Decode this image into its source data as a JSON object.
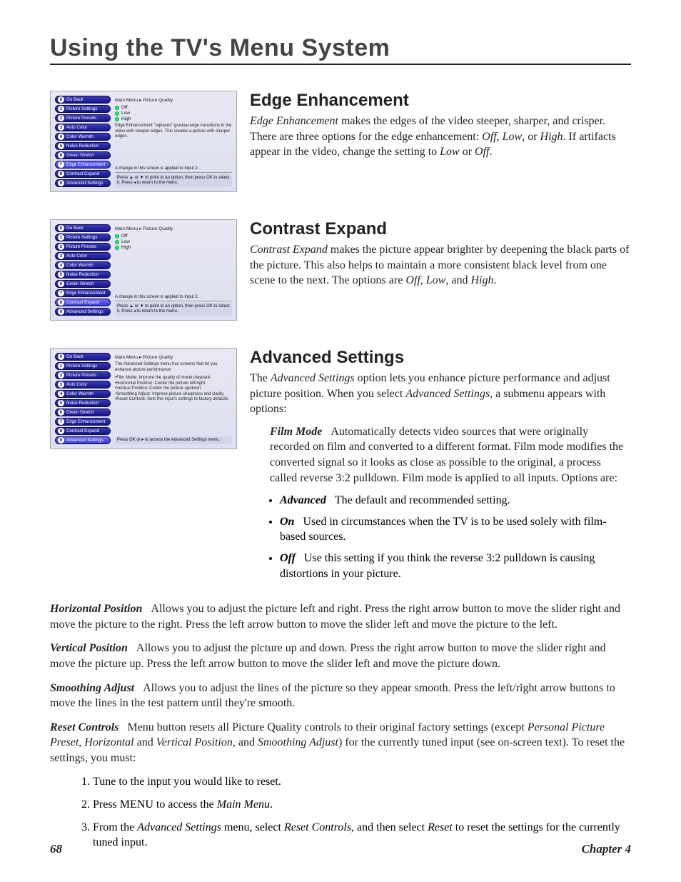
{
  "chapterTitle": "Using the TV's Menu System",
  "sideMenu": {
    "breadcrumb": "Main Menu ▸ Picture Quality",
    "items": [
      {
        "num": "0",
        "label": "Go Back"
      },
      {
        "num": "1",
        "label": "Picture Settings"
      },
      {
        "num": "2",
        "label": "Picture Presets"
      },
      {
        "num": "3",
        "label": "Auto Color"
      },
      {
        "num": "4",
        "label": "Color Warmth"
      },
      {
        "num": "5",
        "label": "Noise Reduction"
      },
      {
        "num": "6",
        "label": "Green Stretch"
      },
      {
        "num": "7",
        "label": "Edge Enhancement"
      },
      {
        "num": "8",
        "label": "Contrast Expand"
      },
      {
        "num": "9",
        "label": "Advanced Settings"
      }
    ]
  },
  "options": {
    "off": "Off",
    "low": "Low",
    "high": "High"
  },
  "shot1": {
    "desc": "Edge Enhancement \"replaces\" gradual edge transitions in the video with steeper edges. This creates a picture with sharper edges.",
    "note": "A change in this screen is applied to Input 2.",
    "press": "Press ▲ or ▼ to point to an option, then press OK to select it. Press ◂ to return to the menu."
  },
  "shot2": {
    "note": "A change in this screen is applied to Input 2.",
    "press": "Press ▲ or ▼ to point to an option, then press OK to select it. Press ◂ to return to the menu."
  },
  "shot3": {
    "desc": "The Advanced Settings menu has screens that let you enhance picture performance:",
    "lines": [
      "•Film Mode: Improve the quality of movie playback.",
      "•Horizontal Position: Center the picture left/right.",
      "•Vertical Position: Center the picture up/down.",
      "•Smoothing Adjust: Improve picture sharpness and clarity.",
      "•Reset Controls: Sets this input's settings to factory defaults."
    ],
    "press": "Press OK or ▸ to access the Advanced Settings menu."
  },
  "sec1": {
    "head": "Edge Enhancement",
    "body": "<em>Edge Enhancement</em> makes the edges of the video steeper, sharper, and crisper. There are three options for the edge enhancement: <em>Off</em>, <em>Low</em>, or <em>High</em>. If artifacts appear in the video, change the setting to <em>Low</em> or <em>Off</em>."
  },
  "sec2": {
    "head": "Contrast Expand",
    "body": "<em>Contrast Expand</em> makes the picture appear brighter by deepening the black parts of the picture. This also helps to maintain a more consistent black level from one scene to the next. The options are <em>Off</em>, <em>Low</em>, and <em>High</em>."
  },
  "sec3": {
    "head": "Advanced Settings",
    "body": "The <em>Advanced Settings</em> option lets you enhance picture performance and adjust picture position. When you select <em>Advanced Settings</em>, a submenu appears with options:",
    "filmMode": "<span class='lead-strong'>Film Mode</span>&nbsp;&nbsp;&nbsp;Automatically detects video sources that were originally recorded on film and converted to a different format. Film mode modifies the converted signal so it looks as close as possible to the original, a process called reverse 3:2 pulldown. Film mode is applied to all inputs. Options are:",
    "bullets": [
      {
        "lead": "Advanced",
        "text": "The default and recommended setting."
      },
      {
        "lead": "On",
        "text": "Used in circumstances when the TV is to be used solely with film-based sources."
      },
      {
        "lead": "Off",
        "text": "Use this setting if you think the reverse 3:2 pulldown is causing distortions in your picture."
      }
    ]
  },
  "horiz": "<span class='lead-strong'>Horizontal Position</span>&nbsp;&nbsp;&nbsp;Allows you to adjust the picture left and right. Press the right arrow button to move the slider right and move the picture to the right. Press the left arrow button to move the slider left and move the picture to the left.",
  "vert": "<span class='lead-strong'>Vertical Position</span>&nbsp;&nbsp;&nbsp;Allows you to adjust the picture up and down. Press the right arrow button to move the slider right and move the picture up. Press the left arrow button to move the slider left and move the picture down.",
  "smooth": "<span class='lead-strong'>Smoothing Adjust</span>&nbsp;&nbsp;&nbsp;Allows you to adjust the lines of the picture so they appear smooth. Press the left/right arrow buttons to move the lines in the test pattern until they're smooth.",
  "reset": "<span class='lead-strong'>Reset Controls</span>&nbsp;&nbsp;&nbsp;Menu button resets all Picture Quality controls to their original factory settings (except <em>Personal Picture Preset</em>, <em>Horizontal</em> and <em>Vertical Position,</em> and <em>Smoothing Adjust</em>) for the currently tuned input (see on-screen text). To reset the settings, you must:",
  "steps": [
    "Tune to the input you would like to reset.",
    "Press MENU to access the <em>Main Menu</em>.",
    "From the <em>Advanced Settings</em> menu, select <em>Reset Controls,</em> and then select <em>Reset</em> to reset the settings for the currently tuned input."
  ],
  "footer": {
    "pageNum": "68",
    "chapter": "Chapter 4"
  }
}
